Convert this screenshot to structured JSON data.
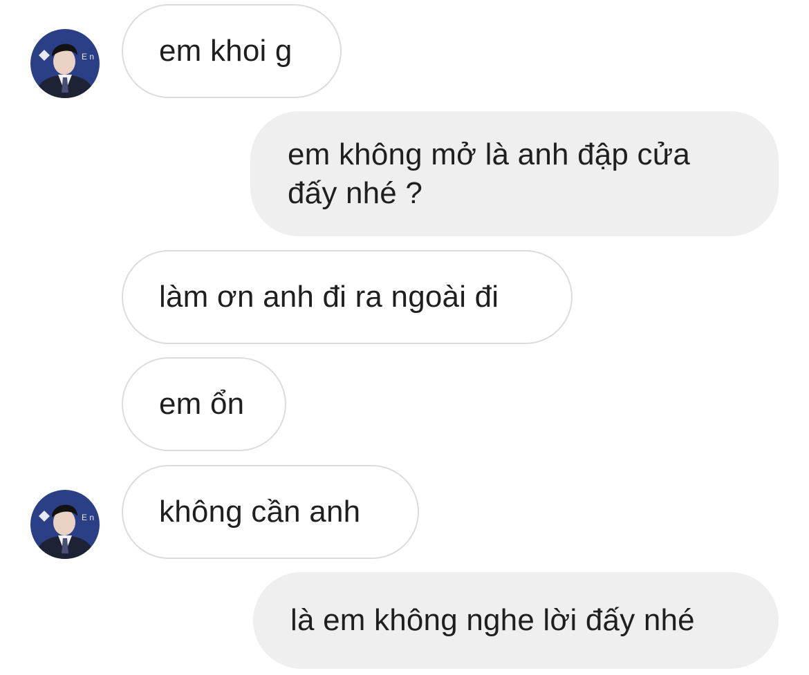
{
  "chat": {
    "messages": [
      {
        "side": "incoming",
        "text": "em khoi g"
      },
      {
        "side": "outgoing",
        "text": "em không mở là anh đập cửa đấy nhé ?"
      },
      {
        "side": "incoming",
        "text": "làm ơn anh đi ra ngoài đi"
      },
      {
        "side": "incoming",
        "text": "em ổn"
      },
      {
        "side": "incoming",
        "text": "không cần anh"
      },
      {
        "side": "outgoing",
        "text": "là em không nghe lời đấy nhé"
      }
    ]
  },
  "avatar": {
    "icon": "profile-photo-icon",
    "bg_color": "#2b3f86",
    "suit_color": "#1d2234",
    "skin_color": "#e9d2c4",
    "hair_color": "#121212"
  },
  "colors": {
    "incoming_bubble": "#ffffff",
    "incoming_border": "#dcdcdc",
    "outgoing_bubble": "#efefef",
    "text": "#1f1f1f"
  }
}
